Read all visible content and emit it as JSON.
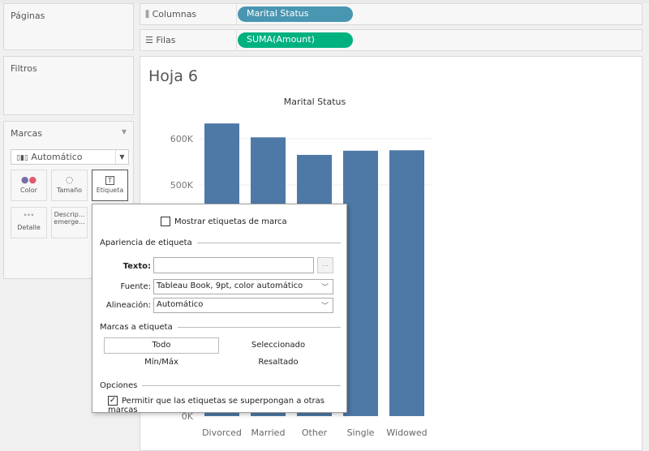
{
  "left": {
    "pages": "Páginas",
    "filters": "Filtros",
    "marks": "Marcas",
    "mark_type": "Automático",
    "cards": [
      {
        "label": "Color",
        "icon": "color-dots-icon"
      },
      {
        "label": "Tamaño",
        "icon": "size-icon"
      },
      {
        "label": "Etiqueta",
        "icon": "text-label-icon"
      },
      {
        "label": "Detalle",
        "icon": "detail-icon"
      },
      {
        "label": "Descrip... emerge...",
        "icon": "tooltip-icon"
      }
    ]
  },
  "shelves": {
    "columns_label": "Columnas",
    "columns_pill": "Marital Status",
    "rows_label": "Filas",
    "rows_pill": "SUMA(Amount)",
    "columns_color": "#4996b2",
    "rows_color": "#00b180"
  },
  "sheet": {
    "title": "Hoja 6"
  },
  "chart_data": {
    "type": "bar",
    "title": "Marital Status",
    "categories": [
      "Divorced",
      "Married",
      "Other",
      "Single",
      "Widowed"
    ],
    "values": [
      633000,
      603000,
      565000,
      574000,
      575000
    ],
    "ylim": [
      0,
      630000
    ],
    "yticks": [
      "0K",
      "500K",
      "600K"
    ],
    "bar_color": "#4e79a7",
    "grid": true
  },
  "dialog": {
    "show_labels": "Mostrar etiquetas de marca",
    "show_labels_checked": false,
    "appearance": "Apariencia de etiqueta",
    "text_label": "Texto:",
    "text_value": "",
    "ellipsis": "...",
    "font_label": "Fuente:",
    "font_value": "Tableau Book, 9pt, color automático",
    "align_label": "Alineación:",
    "align_value": "Automático",
    "marks_to_label": "Marcas a etiqueta",
    "opt_all": "Todo",
    "opt_selected": "Seleccionado",
    "opt_minmax": "Mín/Máx",
    "opt_highlighted": "Resaltado",
    "options": "Opciones",
    "overlap": "Permitir que las etiquetas se superpongan a otras marcas",
    "overlap_checked": true
  }
}
